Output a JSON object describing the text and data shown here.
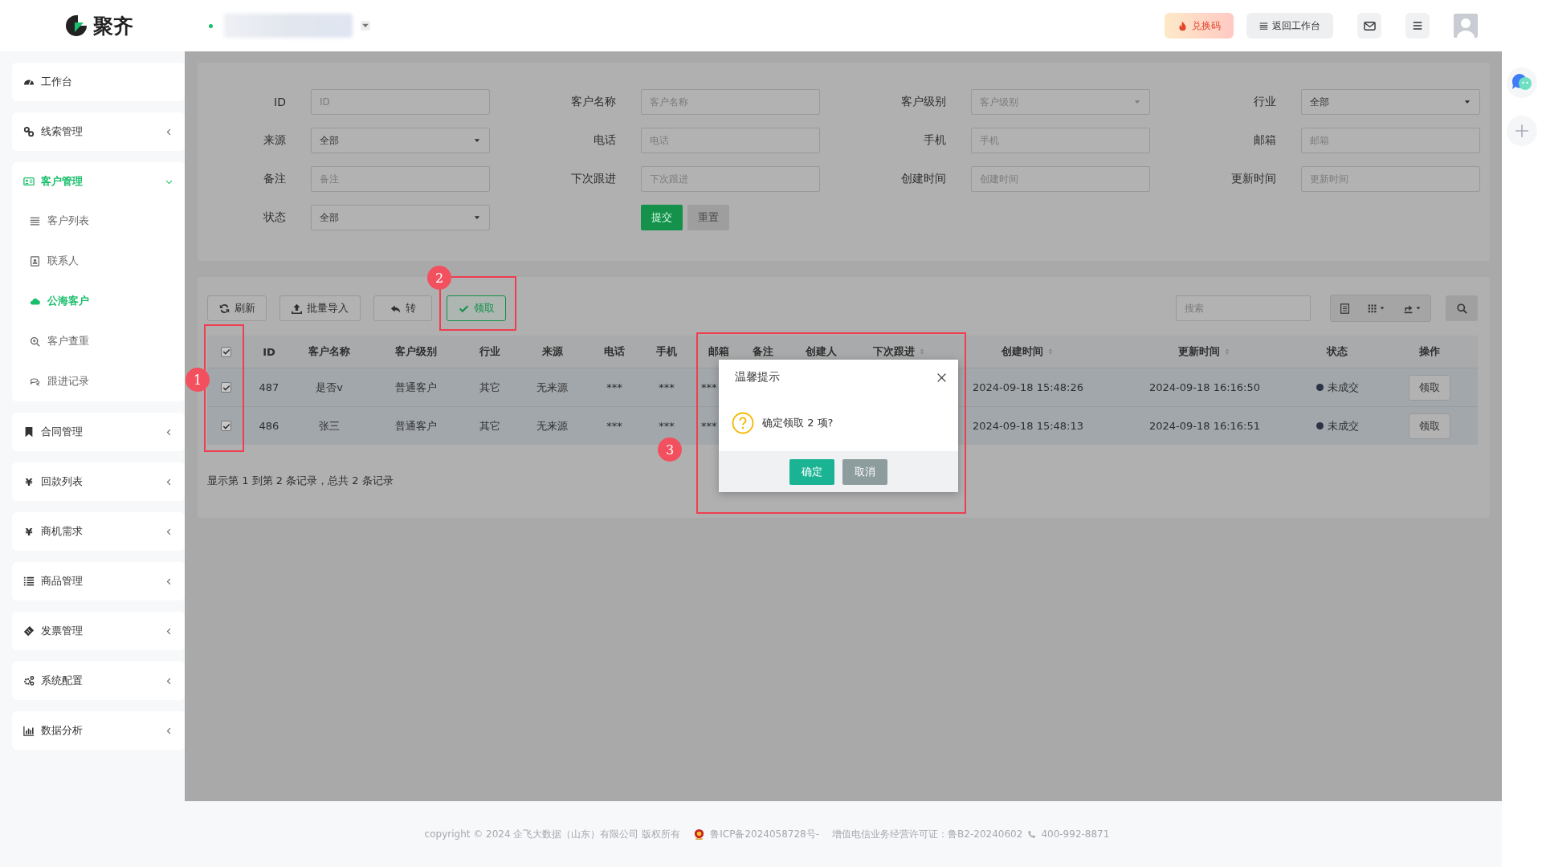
{
  "header": {
    "logo": "聚齐",
    "redeem_button": "兑换码",
    "back_button": "返回工作台"
  },
  "sidebar": [
    {
      "label": "工作台",
      "kind": "link",
      "selected": false
    },
    {
      "label": "线索管理",
      "kind": "group",
      "selected": false,
      "expanded": false
    },
    {
      "label": "客户管理",
      "kind": "group",
      "selected": true,
      "expanded": true,
      "children": [
        {
          "label": "客户列表",
          "selected": false
        },
        {
          "label": "联系人",
          "selected": false
        },
        {
          "label": "公海客户",
          "selected": true
        },
        {
          "label": "客户查重",
          "selected": false
        },
        {
          "label": "跟进记录",
          "selected": false
        }
      ]
    },
    {
      "label": "合同管理",
      "kind": "group",
      "selected": false,
      "expanded": false
    },
    {
      "label": "回款列表",
      "kind": "group",
      "selected": false,
      "expanded": false,
      "glyph": "¥"
    },
    {
      "label": "商机需求",
      "kind": "group",
      "selected": false,
      "expanded": false,
      "glyph": "¥"
    },
    {
      "label": "商品管理",
      "kind": "group",
      "selected": false,
      "expanded": false
    },
    {
      "label": "发票管理",
      "kind": "group",
      "selected": false,
      "expanded": false
    },
    {
      "label": "系统配置",
      "kind": "group",
      "selected": false,
      "expanded": false
    },
    {
      "label": "数据分析",
      "kind": "group",
      "selected": false,
      "expanded": false
    }
  ],
  "filters": [
    {
      "label": "ID",
      "kind": "input",
      "placeholder": "ID"
    },
    {
      "label": "客户名称",
      "kind": "input",
      "placeholder": "客户名称"
    },
    {
      "label": "客户级别",
      "kind": "select",
      "placeholder": "客户级别"
    },
    {
      "label": "行业",
      "kind": "select",
      "value": "全部"
    },
    {
      "label": "来源",
      "kind": "select",
      "value": "全部"
    },
    {
      "label": "电话",
      "kind": "input",
      "placeholder": "电话"
    },
    {
      "label": "手机",
      "kind": "input",
      "placeholder": "手机"
    },
    {
      "label": "邮箱",
      "kind": "input",
      "placeholder": "邮箱"
    },
    {
      "label": "备注",
      "kind": "input",
      "placeholder": "备注"
    },
    {
      "label": "下次跟进",
      "kind": "input",
      "placeholder": "下次跟进"
    },
    {
      "label": "创建时间",
      "kind": "input",
      "placeholder": "创建时间"
    },
    {
      "label": "更新时间",
      "kind": "input",
      "placeholder": "更新时间"
    },
    {
      "label": "状态",
      "kind": "select",
      "value": "全部"
    }
  ],
  "filter_buttons": {
    "submit": "提交",
    "reset": "重置"
  },
  "toolbar": {
    "buttons": [
      {
        "label": "刷新",
        "kind": "refresh"
      },
      {
        "label": "批量导入",
        "kind": "import"
      },
      {
        "label": "转",
        "kind": "transfer"
      },
      {
        "label": "领取",
        "kind": "claim"
      }
    ],
    "search": {
      "placeholder": "搜索"
    }
  },
  "table": {
    "header_checkbox": {
      "checked": true
    },
    "columns": [
      {
        "label": "ID",
        "sortable": false
      },
      {
        "label": "客户名称",
        "sortable": false
      },
      {
        "label": "客户级别",
        "sortable": false
      },
      {
        "label": "行业",
        "sortable": false
      },
      {
        "label": "来源",
        "sortable": false
      },
      {
        "label": "电话",
        "sortable": false
      },
      {
        "label": "手机",
        "sortable": false
      },
      {
        "label": "邮箱",
        "sortable": false
      },
      {
        "label": "备注",
        "sortable": false
      },
      {
        "label": "创建人",
        "sortable": false
      },
      {
        "label": "下次跟进",
        "sortable": true
      },
      {
        "label": "创建时间",
        "sortable": true
      },
      {
        "label": "更新时间",
        "sortable": true
      },
      {
        "label": "状态",
        "sortable": false
      },
      {
        "label": "操作",
        "sortable": false
      }
    ],
    "rows": [
      {
        "selected": true,
        "id": "487",
        "name": "是否v",
        "level": "普通客户",
        "industry": "其它",
        "source": "无来源",
        "phone": "***",
        "mobile": "***",
        "email": "***",
        "created": "2024-09-18 15:48:26",
        "updated": "2024-09-18 16:16:50",
        "status": "未成交",
        "action": "领取"
      },
      {
        "selected": true,
        "id": "486",
        "name": "张三",
        "level": "普通客户",
        "industry": "其它",
        "source": "无来源",
        "phone": "***",
        "mobile": "***",
        "email": "***",
        "created": "2024-09-18 15:48:13",
        "updated": "2024-09-18 16:16:51",
        "status": "未成交",
        "action": "领取"
      }
    ],
    "pagination": "显示第 1 到第 2 条记录，总共 2 条记录"
  },
  "dialog": {
    "title": "温馨提示",
    "message": "确定领取 2 项?",
    "confirm": "确定",
    "cancel": "取消"
  },
  "annotations": [
    {
      "number": "1"
    },
    {
      "number": "2"
    },
    {
      "number": "3"
    }
  ],
  "footer": {
    "copyright": "copyright © 2024 企飞大数据（山东）有限公司 版权所有",
    "icp": "鲁ICP备2024058728号-",
    "license": "增值电信业务经营许可证：鲁B2-20240602",
    "phone": "400-992-8871"
  }
}
